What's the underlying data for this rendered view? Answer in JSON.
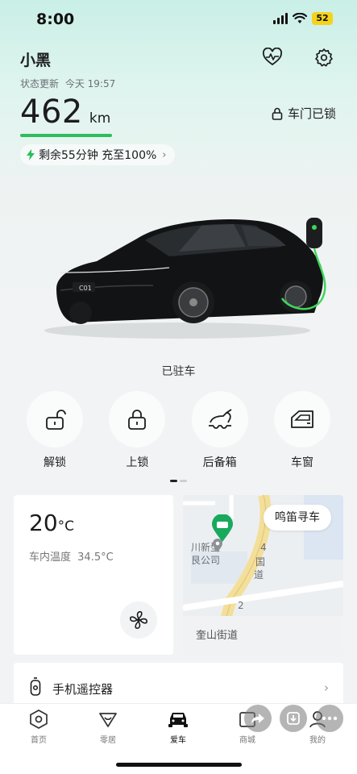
{
  "status_bar": {
    "time": "8:00",
    "battery": "52"
  },
  "vehicle": {
    "name": "小黑",
    "update_label": "状态更新",
    "update_time": "今天 19:57",
    "range_value": "462",
    "range_unit": "km",
    "door_status": "车门已锁",
    "charge_text": "剩余55分钟 充至100%",
    "parked_status": "已驻车",
    "plate_text": "C01"
  },
  "controls": [
    {
      "label": "解锁",
      "icon": "unlock-icon"
    },
    {
      "label": "上锁",
      "icon": "lock-icon"
    },
    {
      "label": "后备箱",
      "icon": "trunk-icon"
    },
    {
      "label": "车窗",
      "icon": "window-icon"
    }
  ],
  "climate": {
    "temp_value": "20",
    "temp_unit": "°C",
    "inside_label": "车内温度",
    "inside_value": "34.5°C"
  },
  "map": {
    "honk_button": "鸣笛寻车",
    "street": "奎山街道",
    "poi_text_1": "川新型",
    "poi_text_2": "艮公司",
    "road_text_1": "4",
    "road_text_2": "国",
    "road_text_3": "道",
    "road_text_4": "2"
  },
  "remote": {
    "label": "手机遥控器"
  },
  "tabs": [
    {
      "label": "首页",
      "active": false
    },
    {
      "label": "零居",
      "active": false
    },
    {
      "label": "爱车",
      "active": true
    },
    {
      "label": "商城",
      "active": false
    },
    {
      "label": "我的",
      "active": false
    }
  ],
  "colors": {
    "accent_green": "#2dbd5b",
    "charge_cable": "#3fd65a"
  }
}
